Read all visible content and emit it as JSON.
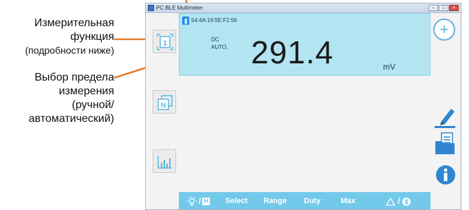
{
  "annotations": {
    "measure_function": {
      "line1": "Измерительная",
      "line2": "функция",
      "line3": "(подробности ниже)"
    },
    "range_select": {
      "line1": "Выбор предела",
      "line2": "измерения",
      "line3": "(ручной/",
      "line4": "автоматический)"
    },
    "accent_color": "#e07a2e"
  },
  "window": {
    "title": "PC BLE Multimeter",
    "controls": [
      "minimize",
      "maximize",
      "close"
    ]
  },
  "display": {
    "device_address": "54:4A:16:5E:F1:56",
    "mode_line1": "DC",
    "mode_line2": "AUTO,",
    "reading": "291.4",
    "unit": "mV",
    "panel_color": "#b2e4f2"
  },
  "sidebar": {
    "items": [
      {
        "icon": "hold-1-icon",
        "label": "1"
      },
      {
        "icon": "relative-n-icon",
        "label": "N"
      },
      {
        "icon": "bar-chart-icon"
      }
    ]
  },
  "right_panel": {
    "add_label": "+",
    "icons": [
      "pen-icon",
      "folder-icon",
      "info-icon"
    ]
  },
  "bottombar": {
    "light_h_label": "H",
    "buttons": {
      "select": "Select",
      "range": "Range",
      "duty": "Duty",
      "max": "Max"
    },
    "bar_color": "#73c9ea"
  }
}
